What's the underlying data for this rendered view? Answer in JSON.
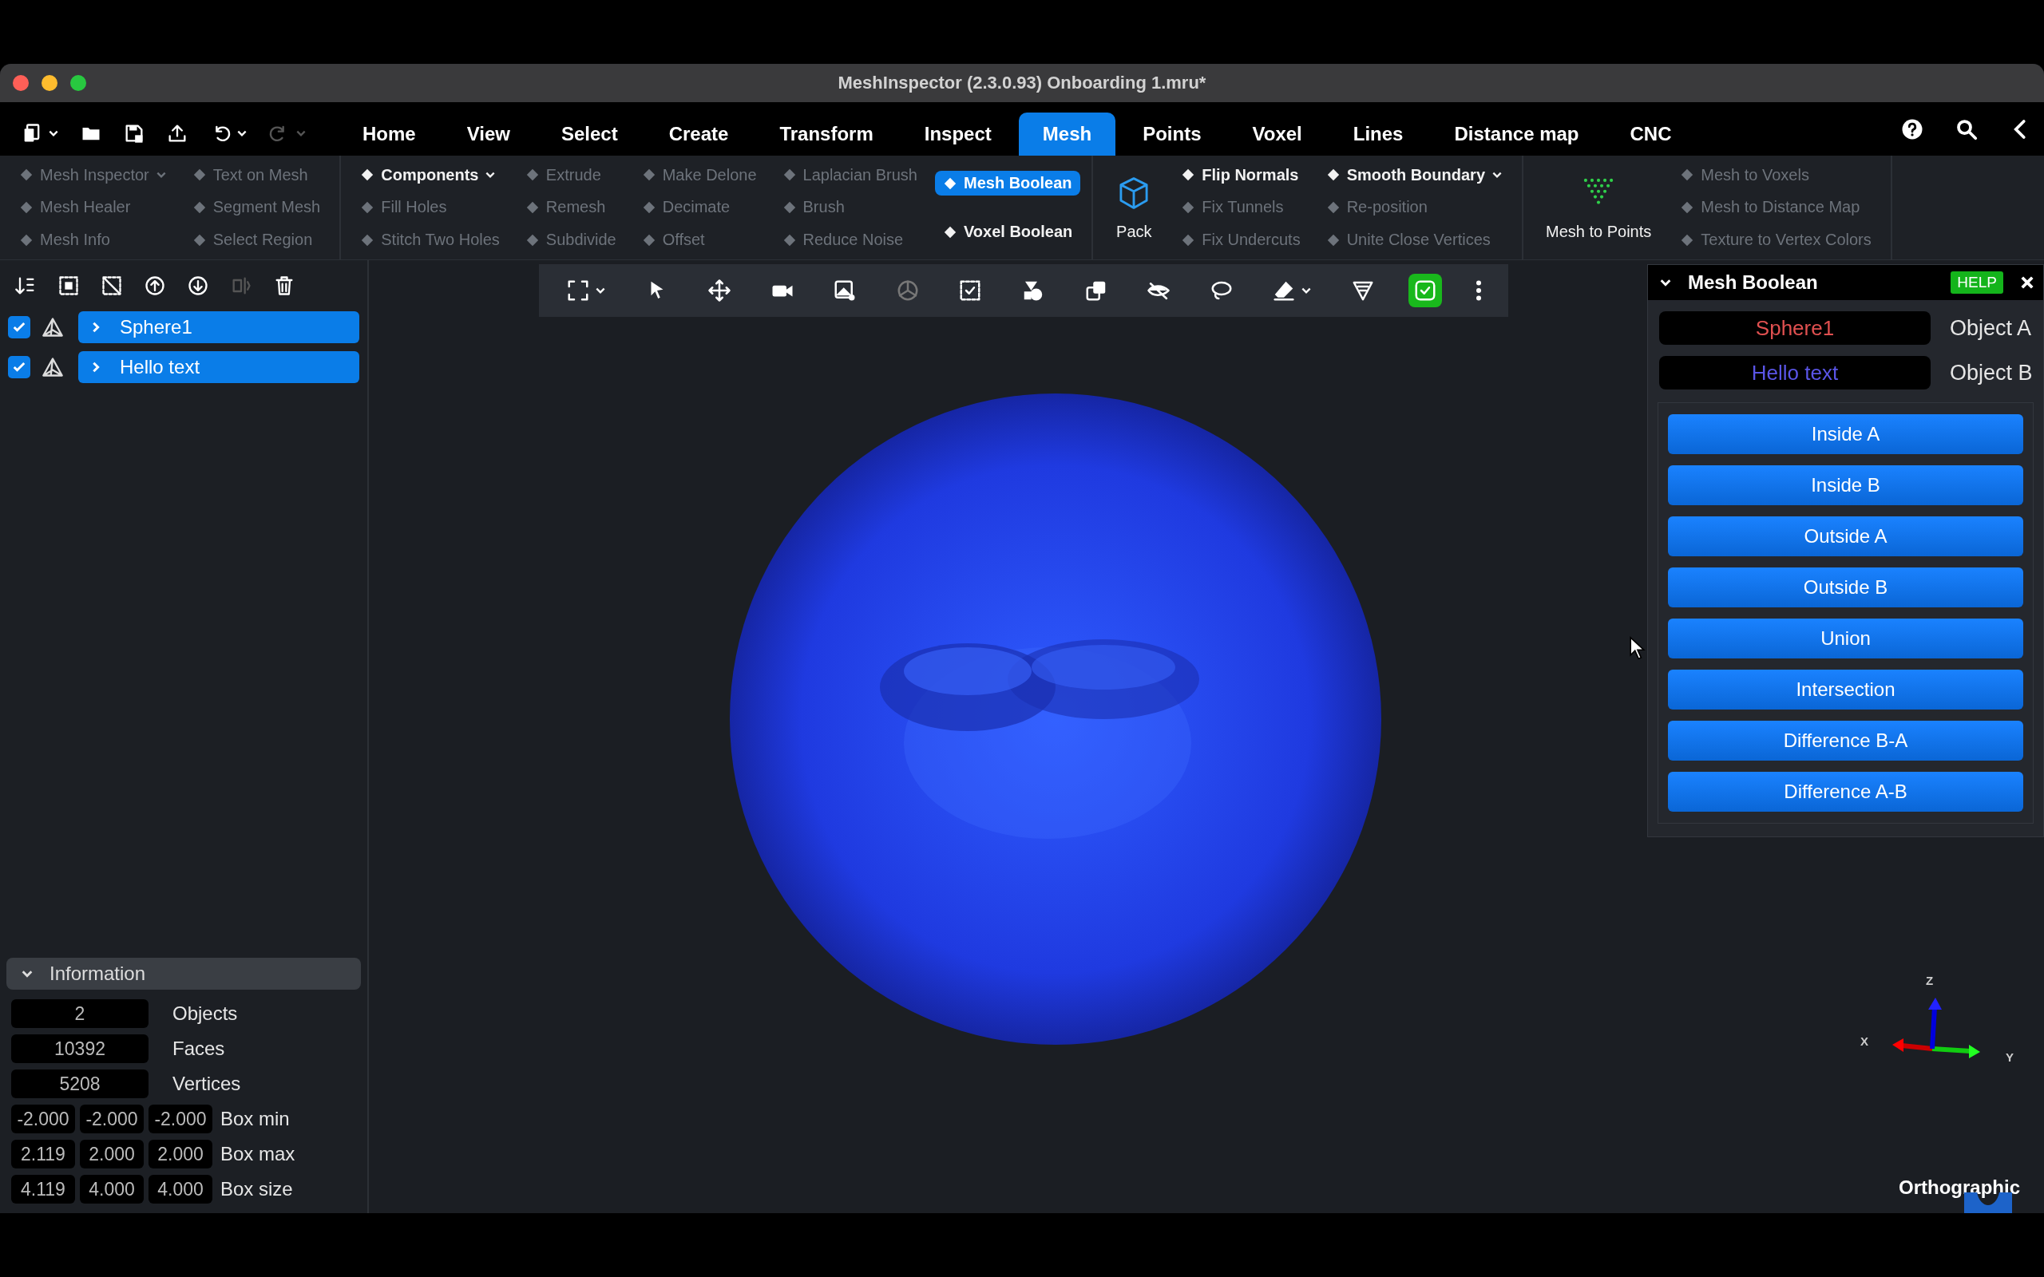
{
  "window": {
    "title": "MeshInspector (2.3.0.93) Onboarding 1.mru*"
  },
  "quick_tools": [
    {
      "disabled": false
    },
    {
      "disabled": false
    },
    {
      "disabled": false
    },
    {
      "disabled": false
    },
    {
      "disabled": false
    },
    {
      "disabled": true
    }
  ],
  "tabs": [
    {
      "label": "Home",
      "selected": false
    },
    {
      "label": "View",
      "selected": false
    },
    {
      "label": "Select",
      "selected": false
    },
    {
      "label": "Create",
      "selected": false
    },
    {
      "label": "Transform",
      "selected": false
    },
    {
      "label": "Inspect",
      "selected": false
    },
    {
      "label": "Mesh",
      "selected": true
    },
    {
      "label": "Points",
      "selected": false
    },
    {
      "label": "Voxel",
      "selected": false
    },
    {
      "label": "Lines",
      "selected": false
    },
    {
      "label": "Distance map",
      "selected": false
    },
    {
      "label": "CNC",
      "selected": false
    }
  ],
  "ribbon": {
    "groups": [
      {
        "columns": [
          {
            "kind": "stack",
            "items": [
              {
                "label": "Mesh Inspector",
                "kind": "dropdown",
                "disabled": true,
                "selected": false
              },
              {
                "label": "Mesh Healer",
                "kind": "button",
                "disabled": true,
                "selected": false
              },
              {
                "label": "Mesh Info",
                "kind": "button",
                "disabled": true,
                "selected": false
              }
            ]
          },
          {
            "kind": "stack",
            "items": [
              {
                "label": "Text on Mesh",
                "kind": "button",
                "disabled": true,
                "selected": false
              },
              {
                "label": "Segment Mesh",
                "kind": "button",
                "disabled": true,
                "selected": false
              },
              {
                "label": "Select Region",
                "kind": "button",
                "disabled": true,
                "selected": false
              }
            ]
          }
        ]
      },
      {
        "columns": [
          {
            "kind": "stack",
            "items": [
              {
                "label": "Components",
                "kind": "dropdown",
                "disabled": false,
                "selected": false
              },
              {
                "label": "Fill Holes",
                "kind": "button",
                "disabled": true,
                "selected": false
              },
              {
                "label": "Stitch Two Holes",
                "kind": "button",
                "disabled": true,
                "selected": false
              }
            ]
          },
          {
            "kind": "stack",
            "items": [
              {
                "label": "Extrude",
                "kind": "button",
                "disabled": true,
                "selected": false
              },
              {
                "label": "Remesh",
                "kind": "button",
                "disabled": true,
                "selected": false
              },
              {
                "label": "Subdivide",
                "kind": "button",
                "disabled": true,
                "selected": false
              }
            ]
          },
          {
            "kind": "stack",
            "items": [
              {
                "label": "Make Delone",
                "kind": "button",
                "disabled": true,
                "selected": false
              },
              {
                "label": "Decimate",
                "kind": "button",
                "disabled": true,
                "selected": false
              },
              {
                "label": "Offset",
                "kind": "button",
                "disabled": true,
                "selected": false
              }
            ]
          },
          {
            "kind": "stack",
            "items": [
              {
                "label": "Laplacian Brush",
                "kind": "button",
                "disabled": true,
                "selected": false
              },
              {
                "label": "Brush",
                "kind": "button",
                "disabled": true,
                "selected": false
              },
              {
                "label": "Reduce Noise",
                "kind": "button",
                "disabled": true,
                "selected": false
              }
            ]
          },
          {
            "kind": "stack",
            "items": [
              {
                "label": "Mesh Boolean",
                "kind": "button",
                "disabled": false,
                "selected": true
              },
              {
                "label": "Voxel Boolean",
                "kind": "button",
                "disabled": false,
                "selected": false
              }
            ]
          }
        ]
      },
      {
        "columns": [
          {
            "kind": "big",
            "label": "Pack",
            "disabled": false
          },
          {
            "kind": "stack",
            "items": [
              {
                "label": "Flip Normals",
                "kind": "button",
                "disabled": false,
                "selected": false
              },
              {
                "label": "Fix Tunnels",
                "kind": "button",
                "disabled": true,
                "selected": false
              },
              {
                "label": "Fix Undercuts",
                "kind": "button",
                "disabled": true,
                "selected": false
              }
            ]
          },
          {
            "kind": "stack",
            "items": [
              {
                "label": "Smooth Boundary",
                "kind": "dropdown",
                "disabled": false,
                "selected": false
              },
              {
                "label": "Re-position",
                "kind": "button",
                "disabled": true,
                "selected": false
              },
              {
                "label": "Unite Close Vertices",
                "kind": "button",
                "disabled": true,
                "selected": false
              }
            ]
          }
        ]
      },
      {
        "columns": [
          {
            "kind": "big",
            "label": "Mesh to Points",
            "disabled": false
          },
          {
            "kind": "stack",
            "items": [
              {
                "label": "Mesh to Voxels",
                "kind": "button",
                "disabled": true,
                "selected": false
              },
              {
                "label": "Mesh to Distance Map",
                "kind": "button",
                "disabled": true,
                "selected": false
              },
              {
                "label": "Texture to Vertex Colors",
                "kind": "button",
                "disabled": true,
                "selected": false
              }
            ]
          }
        ]
      }
    ]
  },
  "scene_tools": [
    {
      "disabled": false
    },
    {
      "disabled": false
    },
    {
      "disabled": false
    },
    {
      "disabled": false
    },
    {
      "disabled": false
    },
    {
      "disabled": true
    },
    {
      "disabled": false
    }
  ],
  "tree": [
    {
      "label": "Sphere1",
      "checked": true,
      "selected": true,
      "expanded": false
    },
    {
      "label": "Hello text",
      "checked": true,
      "selected": true,
      "expanded": false
    }
  ],
  "information": {
    "title": "Information",
    "expanded": true,
    "rows": [
      {
        "values": [
          "2"
        ],
        "label": "Objects"
      },
      {
        "values": [
          "10392"
        ],
        "label": "Faces"
      },
      {
        "values": [
          "5208"
        ],
        "label": "Vertices"
      },
      {
        "values": [
          "-2.000",
          "-2.000",
          "-2.000"
        ],
        "label": "Box min"
      },
      {
        "values": [
          "2.119",
          "2.000",
          "2.000"
        ],
        "label": "Box max"
      },
      {
        "values": [
          "4.119",
          "4.000",
          "4.000"
        ],
        "label": "Box size"
      }
    ]
  },
  "viewport_toolbar": [
    {
      "disabled": false,
      "on": false
    },
    {
      "disabled": false,
      "on": false
    },
    {
      "disabled": false,
      "on": false
    },
    {
      "disabled": false,
      "on": false
    },
    {
      "disabled": false,
      "on": false
    },
    {
      "disabled": true,
      "on": false
    },
    {
      "disabled": false,
      "on": false
    },
    {
      "disabled": false,
      "on": false
    },
    {
      "disabled": false,
      "on": false
    },
    {
      "disabled": false,
      "on": false
    },
    {
      "disabled": false,
      "on": false
    },
    {
      "disabled": false,
      "on": false
    },
    {
      "disabled": false,
      "on": false
    },
    {
      "disabled": false,
      "on": true
    },
    {
      "disabled": false,
      "on": false
    }
  ],
  "mesh_boolean": {
    "title": "Mesh Boolean",
    "help": "HELP",
    "expanded": true,
    "objects": [
      {
        "value": "Sphere1",
        "label": "Object A",
        "color": "#e05050"
      },
      {
        "value": "Hello text",
        "label": "Object B",
        "color": "#5a55e6"
      }
    ],
    "operations": [
      "Inside A",
      "Inside B",
      "Outside A",
      "Outside B",
      "Union",
      "Intersection",
      "Difference B-A",
      "Difference A-B"
    ]
  },
  "viewport": {
    "projection": "Orthographic",
    "axes": [
      {
        "label": "X"
      },
      {
        "label": "Y"
      },
      {
        "label": "Z"
      }
    ]
  }
}
